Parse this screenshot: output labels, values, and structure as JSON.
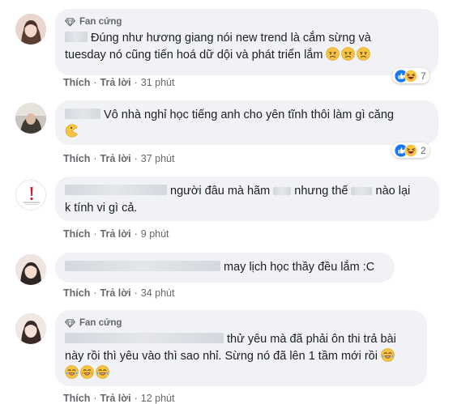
{
  "comments": [
    {
      "badge": "Fan cứng",
      "text_line1": "Đúng như hương giang nói new trend là cắm sừng và",
      "text_line2": "tuesday nó cũng tiến hoá dữ dội và phát triển lắm",
      "like": "Thích",
      "reply": "Trả lời",
      "time": "31 phút",
      "reaction_count": "7",
      "emoji": "confused-face"
    },
    {
      "text_line1": "Vô nhà nghỉ học tiếng anh cho yên tĩnh thôi làm gì căng",
      "like": "Thích",
      "reply": "Trả lời",
      "time": "37 phút",
      "reaction_count": "2",
      "emoji": "pacman"
    },
    {
      "text_line1a": "người đâu mà hãm",
      "text_line1b": "nhưng thế",
      "text_line1c": "nào lại",
      "text_line2": "k tính vi gì cả.",
      "like": "Thích",
      "reply": "Trả lời",
      "time": "9 phút"
    },
    {
      "text_line1": "may lịch học thầy đều lắm :C",
      "like": "Thích",
      "reply": "Trả lời",
      "time": "34 phút"
    },
    {
      "badge": "Fan cứng",
      "text_line1": "thử yêu mà đã phải ôn thi trả bài",
      "text_line2": "này rồi thì yêu vào thì sao nhỉ. Sừng nó đã lên 1 tầm mới rồi",
      "like": "Thích",
      "reply": "Trả lời",
      "time": "12 phút",
      "emoji": "laughing-tears"
    }
  ],
  "colors": {
    "bubble": "#f0f2f5",
    "meta": "#65676b",
    "text": "#1c1e21",
    "like_blue": "#1877f2",
    "haha_yellow": "#f7c444"
  }
}
